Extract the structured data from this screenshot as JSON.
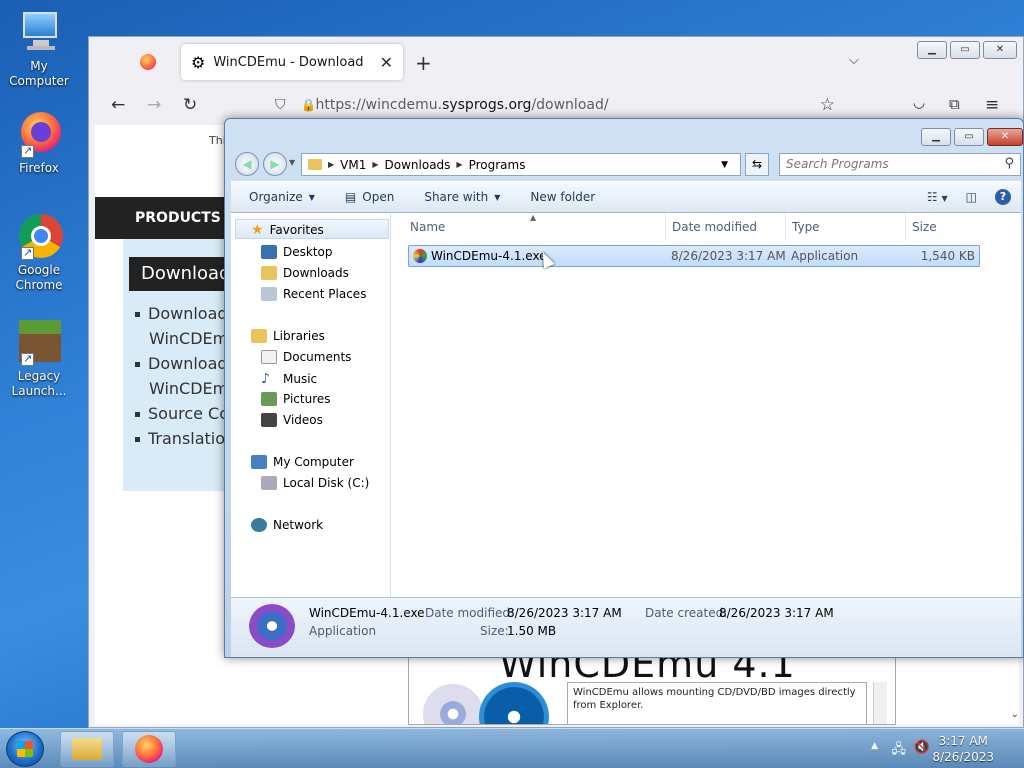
{
  "desktop": {
    "icons": [
      {
        "label": "My Computer"
      },
      {
        "label": "Firefox"
      },
      {
        "label": "Google Chrome"
      },
      {
        "label": "Legacy Launch..."
      }
    ]
  },
  "firefox": {
    "tab_title": "WinCDEmu - Download",
    "url_prefix": "https://wincdemu.",
    "url_domain": "sysprogs.org",
    "url_suffix": "/download/",
    "page": {
      "top_text": "Thi",
      "products": "PRODUCTS",
      "download_heading": "Download",
      "list": [
        "Download",
        "WinCDEmu",
        "Download",
        "WinCDEmu",
        "Source Co",
        "Translation"
      ],
      "promo_title": "WinCDEmu 4.1",
      "promo_desc": "WinCDEmu allows mounting CD/DVD/BD images directly from Explorer."
    }
  },
  "explorer": {
    "breadcrumbs": [
      "VM1",
      "Downloads",
      "Programs"
    ],
    "search_placeholder": "Search Programs",
    "commands": {
      "organize": "Organize",
      "open": "Open",
      "share": "Share with",
      "new_folder": "New folder"
    },
    "tree": {
      "favorites": "Favorites",
      "desktop": "Desktop",
      "downloads": "Downloads",
      "recent": "Recent Places",
      "libraries": "Libraries",
      "documents": "Documents",
      "music": "Music",
      "pictures": "Pictures",
      "videos": "Videos",
      "my_computer": "My Computer",
      "local_disk": "Local Disk (C:)",
      "network": "Network"
    },
    "columns": {
      "name": "Name",
      "date": "Date modified",
      "type": "Type",
      "size": "Size"
    },
    "file": {
      "name": "WinCDEmu-4.1.exe",
      "date": "8/26/2023 3:17 AM",
      "type": "Application",
      "size": "1,540 KB"
    },
    "details": {
      "name": "WinCDEmu-4.1.exe",
      "kind": "Application",
      "date_modified_label": "Date modified:",
      "date_modified": "8/26/2023 3:17 AM",
      "date_created_label": "Date created:",
      "date_created": "8/26/2023 3:17 AM",
      "size_label": "Size:",
      "size": "1.50 MB"
    }
  },
  "taskbar": {
    "time": "3:17 AM",
    "date": "8/26/2023"
  }
}
